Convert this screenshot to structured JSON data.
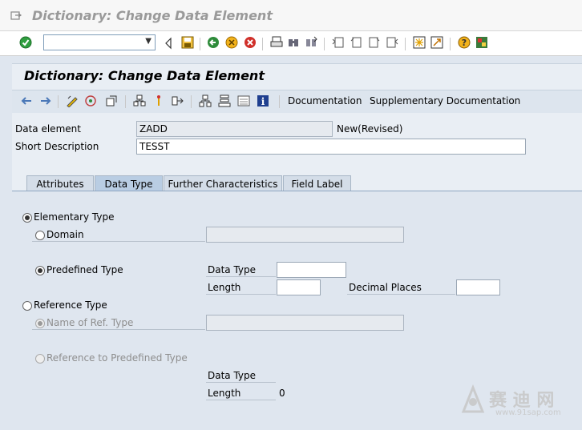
{
  "window": {
    "title": "Dictionary: Change Data Element"
  },
  "system_toolbar": {
    "command_field_value": "",
    "icons": [
      "enter-icon",
      "back-icon",
      "save-icon",
      "back-nav-icon",
      "exit-icon",
      "cancel-icon",
      "print-icon",
      "find-icon",
      "find-next-icon",
      "first-page-icon",
      "prev-page-icon",
      "next-page-icon",
      "last-page-icon",
      "create-session-icon",
      "shortcut-icon",
      "help-icon",
      "layout-icon"
    ]
  },
  "page": {
    "title": "Dictionary: Change Data Element"
  },
  "app_toolbar": {
    "icons": [
      "back-arrow-icon",
      "forward-arrow-icon",
      "display-change-icon",
      "activate-icon",
      "check-icon",
      "where-used-icon",
      "hierarchy-icon",
      "navigate-icon",
      "object-list-icon",
      "stack-icon",
      "details-icon",
      "info-icon"
    ],
    "documentation_label": "Documentation",
    "supplementary_label": "Supplementary Documentation"
  },
  "header": {
    "data_element_label": "Data element",
    "data_element_value": "ZADD",
    "status": "New(Revised)",
    "short_description_label": "Short Description",
    "short_description_value": "TESST"
  },
  "tabs": [
    {
      "label": "Attributes",
      "active": false
    },
    {
      "label": "Data Type",
      "active": true
    },
    {
      "label": "Further Characteristics",
      "active": false
    },
    {
      "label": "Field Label",
      "active": false
    }
  ],
  "data_type_tab": {
    "elementary_type_label": "Elementary Type",
    "domain_label": "Domain",
    "domain_value": "",
    "predefined_type_label": "Predefined Type",
    "data_type_label": "Data Type",
    "data_type_value": "",
    "length_label": "Length",
    "length_value": "",
    "decimal_places_label": "Decimal Places",
    "decimal_places_value": "",
    "reference_type_label": "Reference Type",
    "name_of_ref_type_label": "Name of Ref. Type",
    "name_of_ref_type_value": "",
    "reference_predefined_label": "Reference to Predefined Type",
    "ref_data_type_label": "Data Type",
    "ref_length_label": "Length",
    "ref_length_value": "0"
  },
  "watermark": {
    "text": "赛 迪 网",
    "url": "www.91sap.com"
  },
  "colors": {
    "page_bg": "#dfe6ef",
    "title_grey": "#9a9a9a",
    "active_tab": "#b9cde3"
  }
}
